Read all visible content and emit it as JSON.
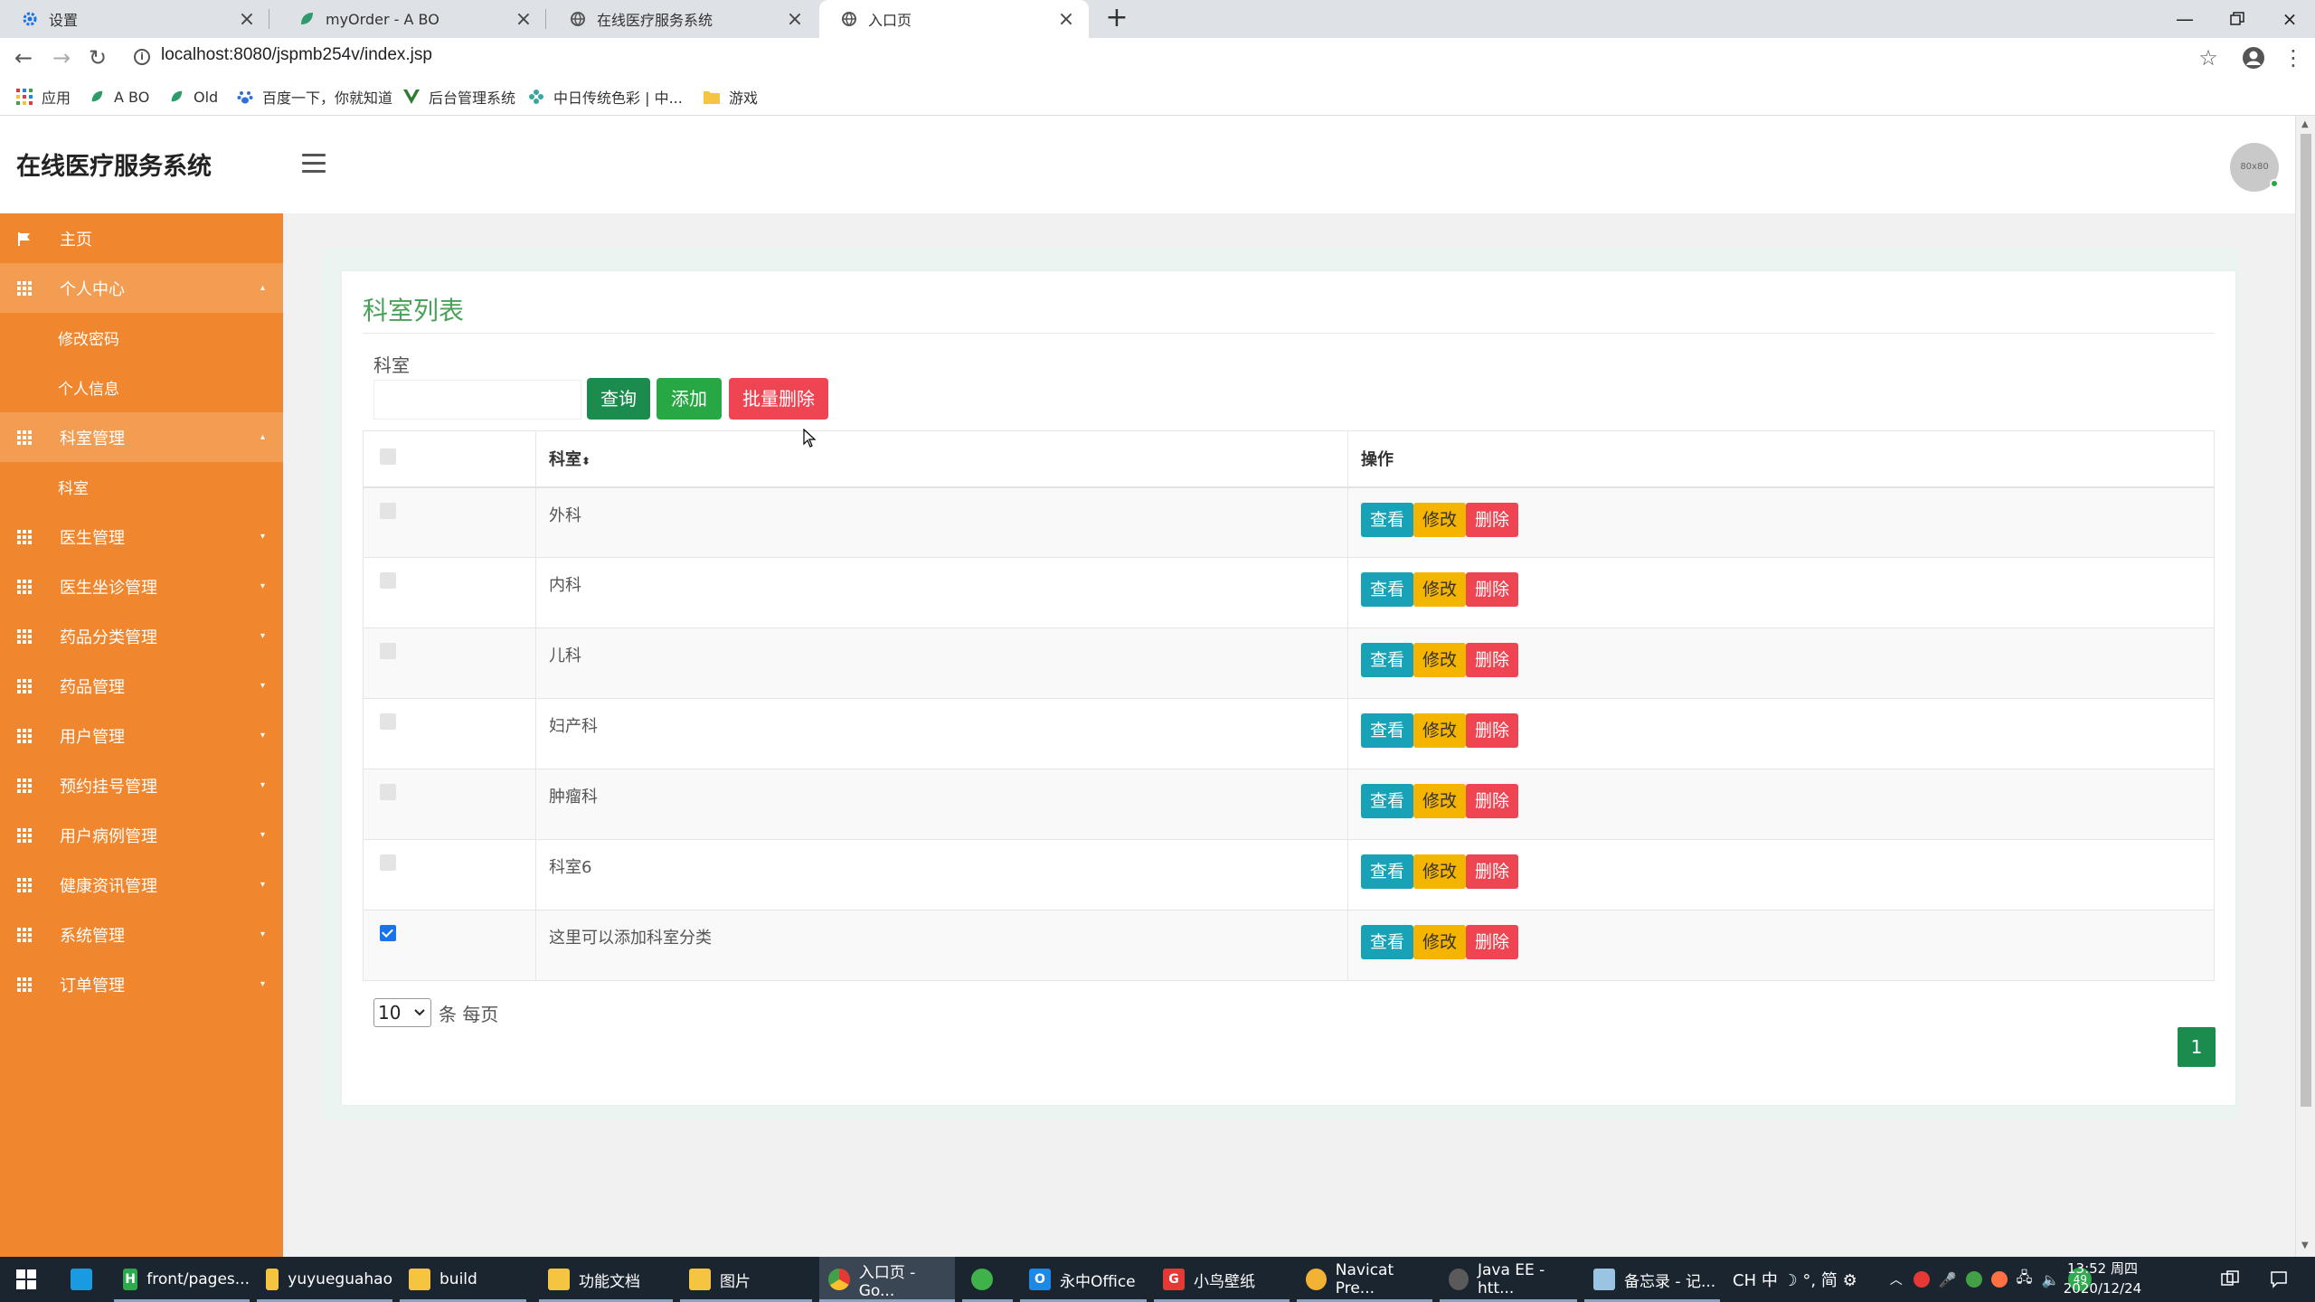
{
  "browser": {
    "tabs": [
      {
        "title": "设置",
        "icon": "gear-icon"
      },
      {
        "title": "myOrder - A BO",
        "icon": "leaf-icon"
      },
      {
        "title": "在线医疗服务系统",
        "icon": "globe-icon"
      },
      {
        "title": "入口页",
        "icon": "globe-icon"
      }
    ],
    "url": "localhost:8080/jspmb254v/index.jsp",
    "bookmarks": [
      "应用",
      "A BO",
      "Old",
      "百度一下，你就知道",
      "后台管理系统",
      "中日传统色彩 | 中...",
      "游戏"
    ]
  },
  "app": {
    "title": "在线医疗服务系统",
    "avatar_text": "80x80",
    "sidebar": {
      "home": "主页",
      "personal": "个人中心",
      "personal_sub": [
        "修改密码",
        "个人信息"
      ],
      "dept": "科室管理",
      "dept_sub": [
        "科室"
      ],
      "items": [
        "医生管理",
        "医生坐诊管理",
        "药品分类管理",
        "药品管理",
        "用户管理",
        "预约挂号管理",
        "用户病例管理",
        "健康资讯管理",
        "系统管理",
        "订单管理"
      ]
    },
    "card_title": "科室列表",
    "search": {
      "label": "科室",
      "value": ""
    },
    "buttons": {
      "search": "查询",
      "add": "添加",
      "batch_delete": "批量删除"
    },
    "table": {
      "col_dept": "科室",
      "col_action": "操作",
      "rows": [
        {
          "name": "外科",
          "checked": false
        },
        {
          "name": "内科",
          "checked": false
        },
        {
          "name": "儿科",
          "checked": false
        },
        {
          "name": "妇产科",
          "checked": false
        },
        {
          "name": "肿瘤科",
          "checked": false
        },
        {
          "name": "科室6",
          "checked": false
        },
        {
          "name": "这里可以添加科室分类",
          "checked": true
        }
      ],
      "actions": {
        "view": "查看",
        "edit": "修改",
        "delete": "删除"
      }
    },
    "pagination": {
      "page_size": "10",
      "suffix": "条 每页",
      "current_page": "1"
    }
  },
  "taskbar": {
    "items": [
      "front/pages...",
      "yuyueguahao",
      "build",
      "功能文档",
      "图片",
      "入口页 - Go...",
      "",
      "永中Office",
      "小鸟壁纸",
      "Navicat Pre...",
      "Java EE - htt...",
      "备忘录 - 记..."
    ],
    "tray": "CH 中 ☽ °, 简 ⚙",
    "clock_time": "13:52 周四",
    "clock_date": "2020/12/24",
    "badge": "49"
  }
}
